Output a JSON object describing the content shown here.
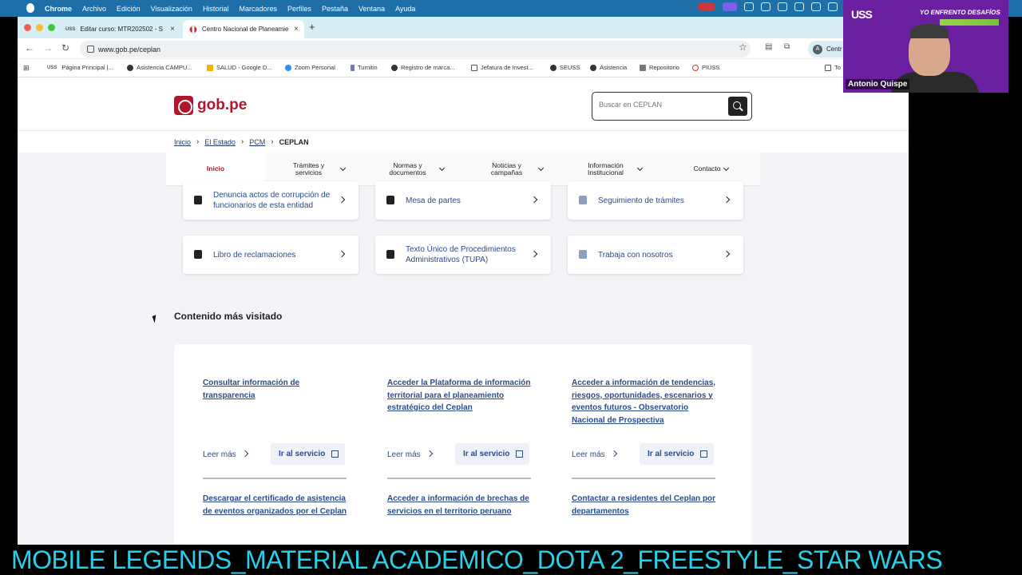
{
  "menubar": {
    "app": "Chrome",
    "items": [
      "Archivo",
      "Edición",
      "Visualización",
      "Historial",
      "Marcadores",
      "Perfiles",
      "Pestaña",
      "Ventana",
      "Ayuda"
    ]
  },
  "tabs": [
    {
      "title": "Editar curso: MTR202502 - S",
      "icon": "uss-icon"
    },
    {
      "title": "Centro Nacional de Planeamie",
      "icon": "peru-flag-icon",
      "active": true
    }
  ],
  "toolbar": {
    "url": "www.gob.pe/ceplan",
    "profile_initial": "A",
    "profile_label": "Centr"
  },
  "bookmarks": [
    "Página Principal |...",
    "Asistencia CAMPU...",
    "SALUD - Google D...",
    "Zoom Personal",
    "Turnitin",
    "Registro de marca...",
    "Jefatura de Invest...",
    "SEUSS",
    "Asistencia",
    "Repositorio",
    "PIUSS"
  ],
  "bookmarks_more": "To",
  "site": {
    "logo": "gob.pe",
    "search_placeholder": "Buscar en CEPLAN",
    "breadcrumb": [
      "Inicio",
      "El Estado",
      "PCM",
      "CEPLAN"
    ],
    "nav": [
      {
        "label": "Inicio",
        "active": true
      },
      {
        "label": "Trámites y servicios"
      },
      {
        "label": "Normas y documentos"
      },
      {
        "label": "Noticias y campañas"
      },
      {
        "label": "Información Institucional"
      },
      {
        "label": "Contacto"
      }
    ],
    "cards": [
      "Denuncia actos de corrupción de funcionarios de esta entidad",
      "Mesa de partes",
      "Seguimiento de trámites",
      "Libro de reclamaciones",
      "Texto Único de Procedimientos Administrativos (TUPA)",
      "Trabaja con nosotros"
    ],
    "visited_title": "Contenido más visitado",
    "visited": [
      "Consultar información de transparencia",
      "Acceder la Plataforma de información territorial para el planeamiento estratégico del Ceplan",
      "Acceder a información de tendencias, riesgos, oportunidades, escenarios y eventos futuros - Observatorio Nacional de Prospectiva",
      "Descargar el certificado de asistencia de eventos organizados por el Ceplan",
      "Acceder a información de brechas de servicios en el territorio peruano",
      "Contactar a residentes del Ceplan por departamentos"
    ],
    "leer_mas": "Leer más",
    "ir_servicio": "Ir al servicio"
  },
  "webcam": {
    "brand": "USS",
    "slogan": "YO ENFRENTO DESAFÍOS",
    "name": "Antonio Quispe"
  },
  "ticker": "MOBILE LEGENDS_MATERIAL ACADEMICO_DOTA 2_FREESTYLE_STAR WARS",
  "colors": {
    "menubar": "#1e6ea7",
    "tabstrip": "#d7eef5",
    "gob_red": "#b1172c",
    "link_blue": "#2b4b8a",
    "ticker_text": "#26d0e8",
    "webcam_bg": "#6a1fa0"
  }
}
